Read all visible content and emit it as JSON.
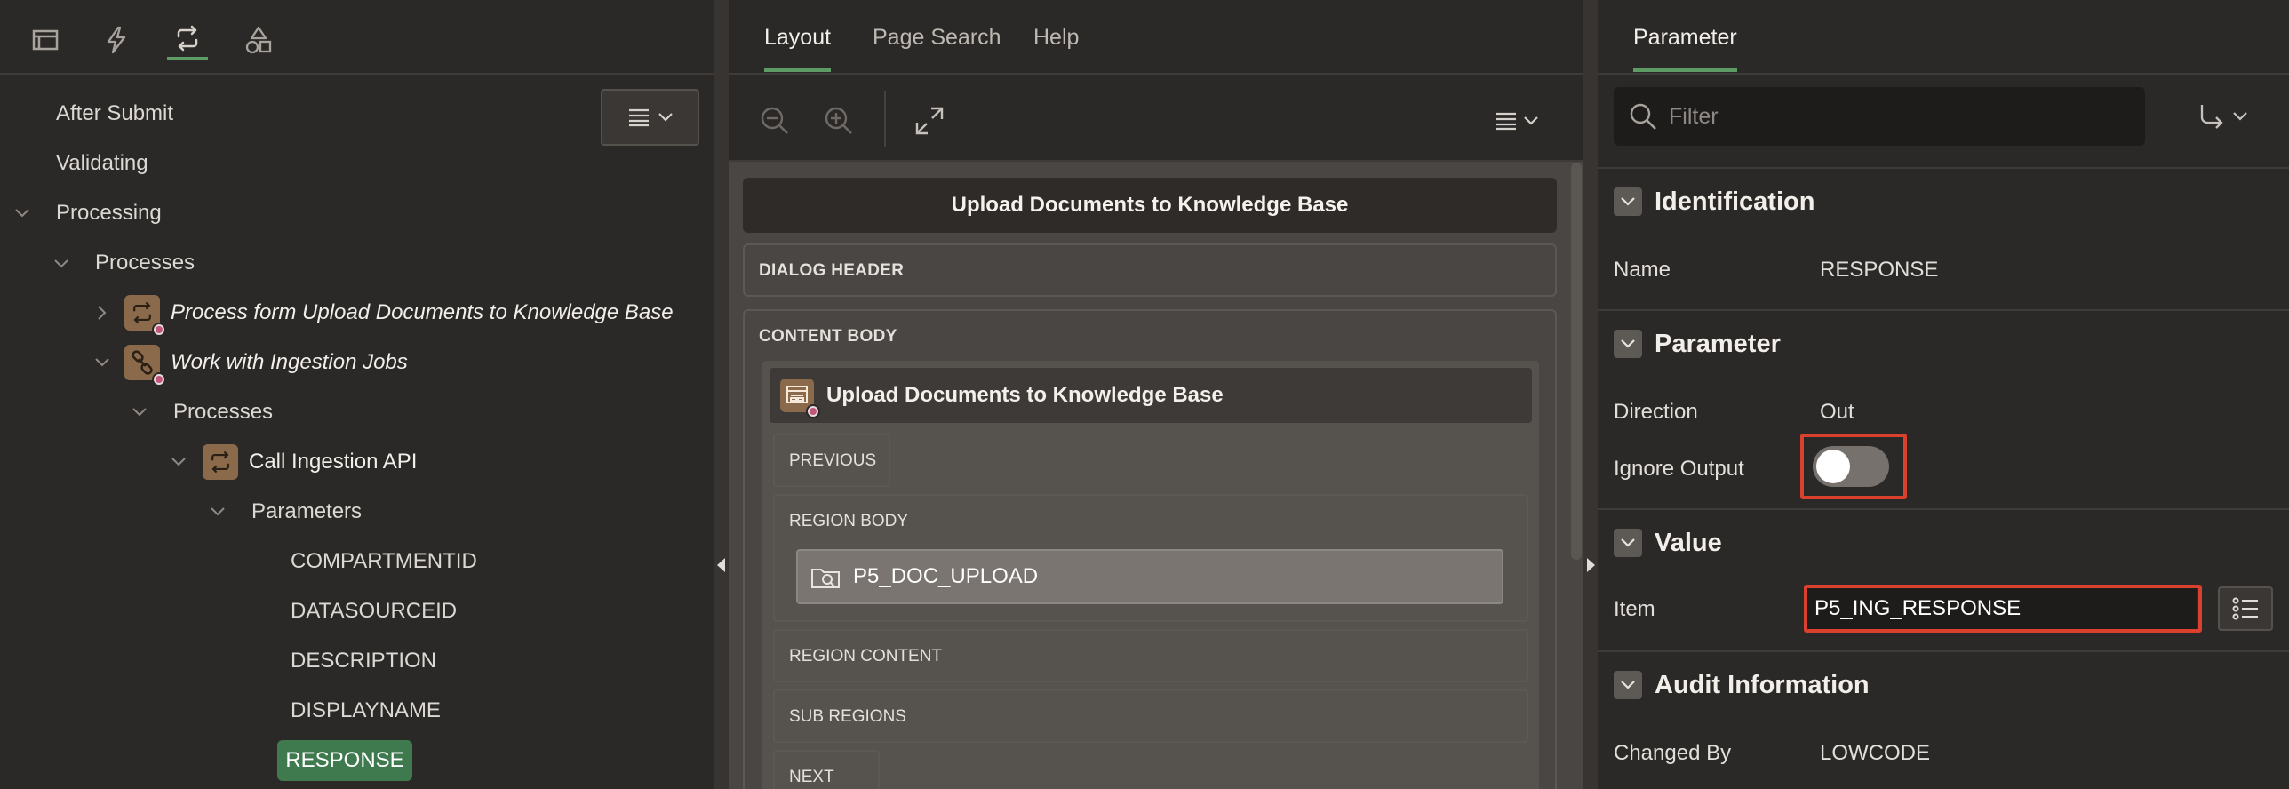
{
  "left": {
    "tabs": [
      {
        "icon": "rendering-icon",
        "active": false
      },
      {
        "icon": "dynamic-actions-icon",
        "active": false
      },
      {
        "icon": "processing-icon",
        "active": true
      },
      {
        "icon": "shared-components-icon",
        "active": false
      }
    ],
    "tree": {
      "after_submit": "After Submit",
      "validating": "Validating",
      "processing": "Processing",
      "processes": "Processes",
      "process_form": "Process form Upload Documents to Knowledge Base",
      "work_with": "Work with Ingestion Jobs",
      "processes2": "Processes",
      "call_api": "Call Ingestion API",
      "parameters": "Parameters",
      "params": [
        "COMPARTMENTID",
        "DATASOURCEID",
        "DESCRIPTION",
        "DISPLAYNAME"
      ],
      "selected": "RESPONSE"
    }
  },
  "center": {
    "tabs": [
      "Layout",
      "Page Search",
      "Help"
    ],
    "active_tab": "Layout",
    "page_title": "Upload Documents to Knowledge Base",
    "dialog_header": "DIALOG HEADER",
    "content_body": "CONTENT BODY",
    "region_title": "Upload Documents to Knowledge Base",
    "previous": "PREVIOUS",
    "region_body": "REGION BODY",
    "item": "P5_DOC_UPLOAD",
    "region_content": "REGION CONTENT",
    "sub_regions": "SUB REGIONS",
    "next": "NEXT"
  },
  "right": {
    "tab": "Parameter",
    "filter_placeholder": "Filter",
    "sections": {
      "identification": "Identification",
      "parameter": "Parameter",
      "value": "Value",
      "audit": "Audit Information"
    },
    "name_label": "Name",
    "name_value": "RESPONSE",
    "direction_label": "Direction",
    "direction_value": "Out",
    "ignore_output_label": "Ignore Output",
    "ignore_output_on": false,
    "item_label": "Item",
    "item_value": "P5_ING_RESPONSE",
    "changed_by_label": "Changed By",
    "changed_by_value": "LOWCODE"
  },
  "colors": {
    "accent_green": "#5e9c66",
    "selected_bg": "#3f7a4e",
    "highlight_red": "#d9412e",
    "component_icon": "#8a6a4a"
  }
}
